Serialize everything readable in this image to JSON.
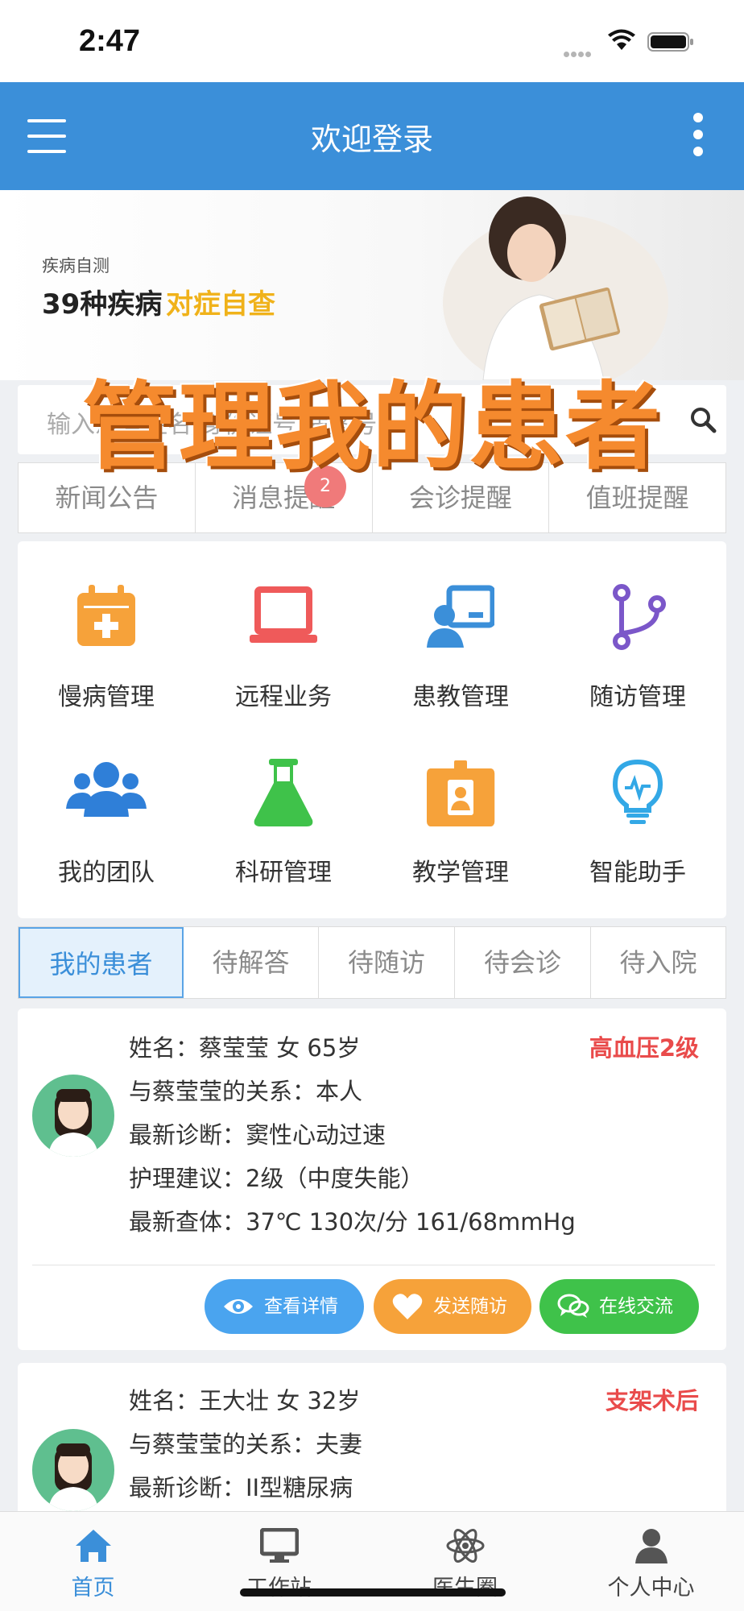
{
  "status": {
    "time": "2:47"
  },
  "header": {
    "title": "欢迎登录"
  },
  "banner": {
    "small": "疾病自测",
    "big": "39种疾病",
    "highlight": "对症自查"
  },
  "overlay": {
    "title": "管理我的患者"
  },
  "search": {
    "text": "输入患者姓名/身份证号/病案号"
  },
  "notices": {
    "items": [
      "新闻公告",
      "消息提醒",
      "会诊提醒",
      "值班提醒"
    ],
    "badge_count": "2"
  },
  "grid": {
    "items": [
      {
        "label": "慢病管理",
        "icon": "calendar-plus-icon",
        "color": "#f6a23a"
      },
      {
        "label": "远程业务",
        "icon": "laptop-icon",
        "color": "#ef5a5a"
      },
      {
        "label": "患教管理",
        "icon": "teacher-screen-icon",
        "color": "#3b8fd9"
      },
      {
        "label": "随访管理",
        "icon": "branch-icon",
        "color": "#7b57c9"
      },
      {
        "label": "我的团队",
        "icon": "team-icon",
        "color": "#2f7fd8"
      },
      {
        "label": "科研管理",
        "icon": "flask-icon",
        "color": "#3fc24a"
      },
      {
        "label": "教学管理",
        "icon": "id-badge-icon",
        "color": "#f6a23a"
      },
      {
        "label": "智能助手",
        "icon": "bulb-icon",
        "color": "#33a8e6"
      }
    ]
  },
  "patient_tabs": [
    "我的患者",
    "待解答",
    "待随访",
    "待会诊",
    "待入院"
  ],
  "patients": [
    {
      "name_line": "姓名：蔡莹莹   女   65岁",
      "tag": "高血压2级",
      "relation": "与蔡莹莹的关系：本人",
      "diagnosis": "最新诊断：窦性心动过速",
      "care": "护理建议：2级（中度失能）",
      "exam": "最新查体：37℃  130次/分  161/68mmHg"
    },
    {
      "name_line": "姓名：王大壮   女   32岁",
      "tag": "支架术后",
      "relation": "与蔡莹莹的关系：夫妻",
      "diagnosis": "最新诊断：II型糖尿病"
    }
  ],
  "actions": {
    "detail": "查看详情",
    "followup": "发送随访",
    "chat": "在线交流"
  },
  "tabbar": [
    "首页",
    "工作站",
    "医生圈",
    "个人中心"
  ],
  "colors": {
    "primary": "#3b8fd9",
    "orange": "#f6a23a",
    "green": "#3fc24a",
    "red": "#e94b4b"
  }
}
